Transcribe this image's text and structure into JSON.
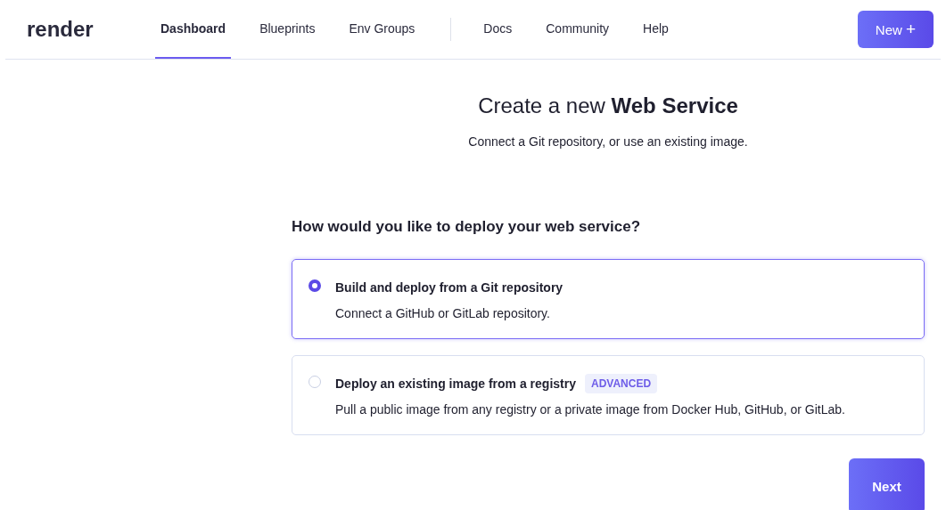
{
  "logo": "render",
  "nav": [
    {
      "label": "Dashboard",
      "selected": true
    },
    {
      "label": "Blueprints",
      "selected": false
    },
    {
      "label": "Env Groups",
      "selected": false
    }
  ],
  "nav_secondary": [
    {
      "label": "Docs"
    },
    {
      "label": "Community"
    },
    {
      "label": "Help"
    }
  ],
  "new_button": {
    "label": "New",
    "icon": "+"
  },
  "title": "Create a new **Web Service**",
  "subtitle": "Connect a Git repository, or use an existing image.",
  "question": "How would you like to deploy your web service?",
  "options": [
    {
      "title": "Build and deploy from a Git repository",
      "description": "Connect a GitHub or GitLab repository.",
      "selected": true
    },
    {
      "title": "Deploy an existing image from a registry",
      "badge": "ADVANCED",
      "description": "Pull a public image from any registry or a private image from Docker Hub, GitHub, or GitLab.",
      "selected": false
    }
  ],
  "next_button": "Next"
}
